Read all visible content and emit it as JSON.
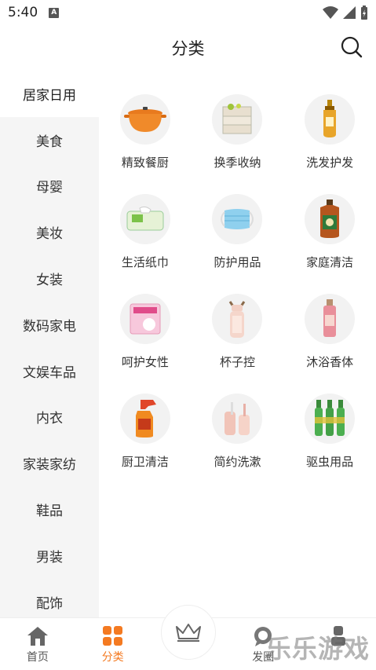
{
  "status": {
    "time": "5:40",
    "indicator": "A"
  },
  "header": {
    "title": "分类"
  },
  "sidebar": {
    "items": [
      {
        "label": "居家日用",
        "active": true
      },
      {
        "label": "美食"
      },
      {
        "label": "母婴"
      },
      {
        "label": "美妆"
      },
      {
        "label": "女装"
      },
      {
        "label": "数码家电"
      },
      {
        "label": "文娱车品"
      },
      {
        "label": "内衣"
      },
      {
        "label": "家装家纺"
      },
      {
        "label": "鞋品"
      },
      {
        "label": "男装"
      },
      {
        "label": "配饰"
      }
    ]
  },
  "categories": [
    {
      "label": "精致餐厨",
      "icon": "casserole-pot-icon"
    },
    {
      "label": "换季收纳",
      "icon": "storage-box-icon"
    },
    {
      "label": "洗发护发",
      "icon": "shampoo-bottle-icon"
    },
    {
      "label": "生活纸巾",
      "icon": "tissue-pack-icon"
    },
    {
      "label": "防护用品",
      "icon": "face-mask-icon"
    },
    {
      "label": "家庭清洁",
      "icon": "disinfectant-bottle-icon"
    },
    {
      "label": "呵护女性",
      "icon": "sanitary-pad-icon"
    },
    {
      "label": "杯子控",
      "icon": "water-bottle-icon"
    },
    {
      "label": "沐浴香体",
      "icon": "body-mist-icon"
    },
    {
      "label": "厨卫清洁",
      "icon": "spray-cleaner-icon"
    },
    {
      "label": "简约洗漱",
      "icon": "toothbrush-cup-icon"
    },
    {
      "label": "驱虫用品",
      "icon": "mosquito-repellent-icon"
    }
  ],
  "nav": {
    "home": "首页",
    "category": "分类",
    "circle": "发圈"
  },
  "watermark": "乐乐游戏",
  "colors": {
    "accent": "#f47a21",
    "sidebar_bg": "#f5f5f5"
  }
}
